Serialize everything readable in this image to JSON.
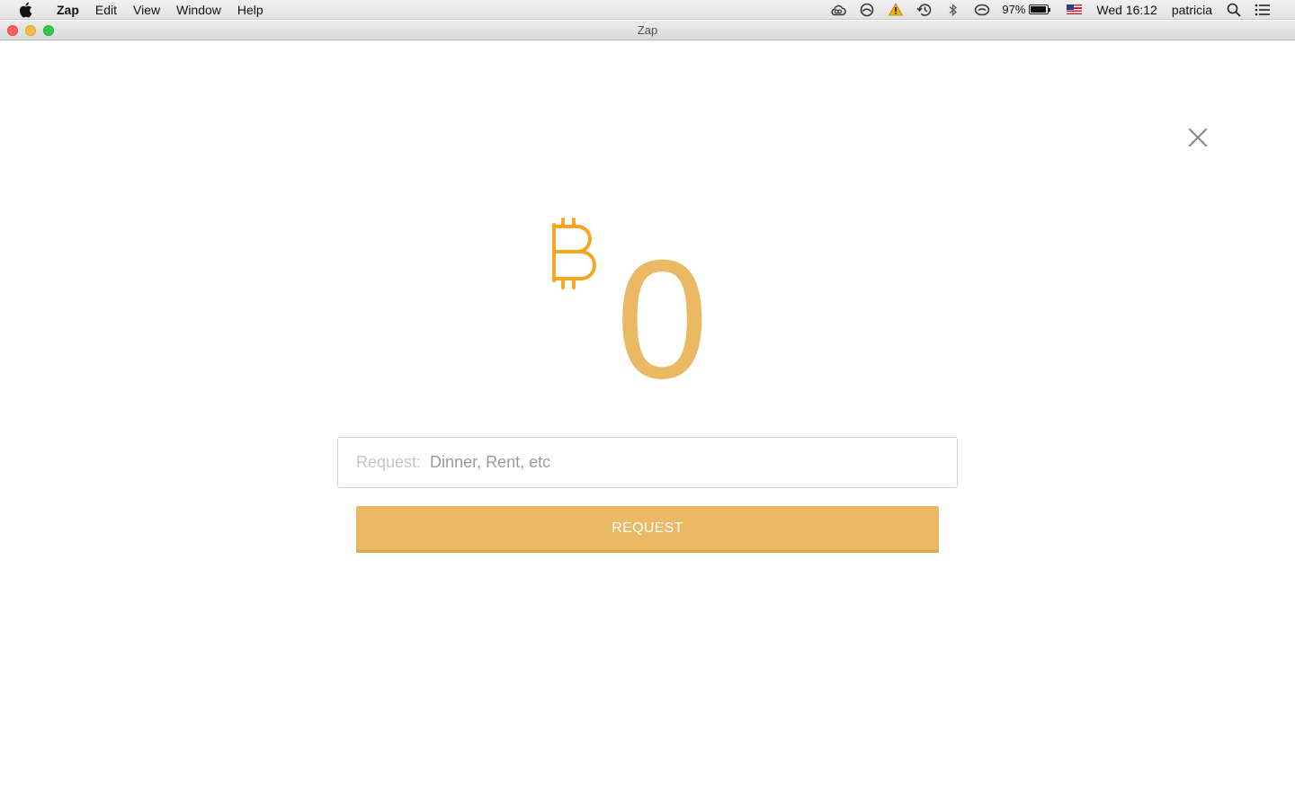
{
  "menubar": {
    "app_name": "Zap",
    "menus": [
      "Edit",
      "View",
      "Window",
      "Help"
    ],
    "status": {
      "battery_percent": "97%",
      "battery_level": 0.97,
      "clock": "Wed 16:12",
      "user": "patricia",
      "icons": [
        "creative-cloud-icon",
        "sync-icon",
        "warning-icon",
        "time-machine-icon",
        "bluetooth-icon",
        "wifi-icon",
        "battery-icon",
        "us-flag-icon",
        "spotlight-search-icon",
        "notification-center-icon"
      ]
    }
  },
  "window": {
    "title": "Zap"
  },
  "request_form": {
    "currency_icon": "bitcoin-icon",
    "amount": "0",
    "field_label": "Request:",
    "field_placeholder": "Dinner, Rent, etc",
    "field_value": "",
    "submit_label": "REQUEST",
    "close_icon": "close-icon"
  },
  "colors": {
    "accent": "#ebb864",
    "bitcoin": "#f5a623",
    "button_border": "#e1a840"
  }
}
